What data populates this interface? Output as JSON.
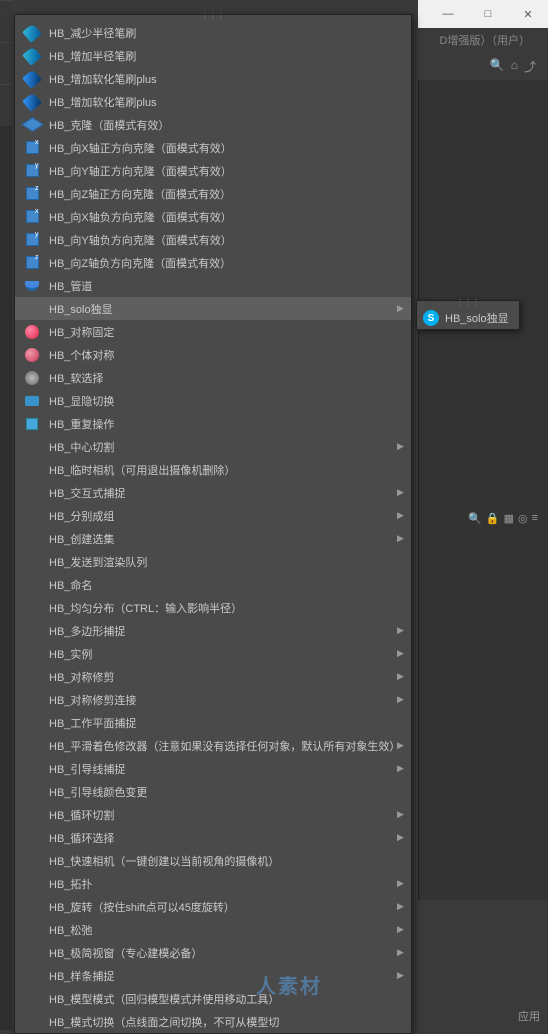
{
  "window": {
    "minimize": "—",
    "maximize": "□",
    "close": "✕",
    "header_suffix": "D增强版）（用户）"
  },
  "toolbar_right": {
    "search": "🔍",
    "home": "⌂",
    "arrow": "⤴"
  },
  "right_tools": {
    "search": "🔍",
    "lock": "🔒",
    "grid": "▦",
    "target": "◎",
    "menu": "≡"
  },
  "menu": {
    "items": [
      {
        "icon": "brush",
        "label": "HB_减少半径笔刷",
        "sub": false
      },
      {
        "icon": "brush",
        "label": "HB_增加半径笔刷",
        "sub": false
      },
      {
        "icon": "brush2",
        "label": "HB_增加软化笔刷plus",
        "sub": false
      },
      {
        "icon": "brush2",
        "label": "HB_增加软化笔刷plus",
        "sub": false
      },
      {
        "icon": "cube",
        "label": "HB_克隆（面模式有效）",
        "sub": false
      },
      {
        "icon": "cubex",
        "label": "HB_向X轴正方向克隆（面模式有效）",
        "sub": false
      },
      {
        "icon": "cubey",
        "label": "HB_向Y轴正方向克隆（面模式有效）",
        "sub": false
      },
      {
        "icon": "cubez",
        "label": "HB_向Z轴正方向克隆（面模式有效）",
        "sub": false
      },
      {
        "icon": "cubex",
        "label": "HB_向X轴负方向克隆（面模式有效）",
        "sub": false
      },
      {
        "icon": "cubey",
        "label": "HB_向Y轴负方向克隆（面模式有效）",
        "sub": false
      },
      {
        "icon": "cubez",
        "label": "HB_向Z轴负方向克隆（面模式有效）",
        "sub": false
      },
      {
        "icon": "pipe",
        "label": "HB_管道",
        "sub": false
      },
      {
        "icon": "none",
        "label": "HB_solo独显",
        "sub": true,
        "hl": true
      },
      {
        "icon": "sphere-r",
        "label": "HB_对称固定",
        "sub": false
      },
      {
        "icon": "sphere-b",
        "label": "HB_个体对称",
        "sub": false
      },
      {
        "icon": "soft",
        "label": "HB_软选择",
        "sub": false
      },
      {
        "icon": "vis",
        "label": "HB_显隐切换",
        "sub": false
      },
      {
        "icon": "cube2",
        "label": "HB_重复操作",
        "sub": false
      },
      {
        "icon": "none",
        "label": "HB_中心切割",
        "sub": true
      },
      {
        "icon": "none",
        "label": "HB_临时相机（可用退出摄像机删除）",
        "sub": false
      },
      {
        "icon": "none",
        "label": "HB_交互式捕捉",
        "sub": true
      },
      {
        "icon": "none",
        "label": "HB_分别成组",
        "sub": true
      },
      {
        "icon": "none",
        "label": "HB_创建选集",
        "sub": true
      },
      {
        "icon": "none",
        "label": "HB_发送到渲染队列",
        "sub": false
      },
      {
        "icon": "none",
        "label": "HB_命名",
        "sub": false
      },
      {
        "icon": "none",
        "label": "HB_均匀分布（CTRL：输入影响半径）",
        "sub": false
      },
      {
        "icon": "none",
        "label": "HB_多边形捕捉",
        "sub": true
      },
      {
        "icon": "none",
        "label": "HB_实例",
        "sub": true
      },
      {
        "icon": "none",
        "label": "HB_对称修剪",
        "sub": true
      },
      {
        "icon": "none",
        "label": "HB_对称修剪连接",
        "sub": true
      },
      {
        "icon": "none",
        "label": "HB_工作平面捕捉",
        "sub": false
      },
      {
        "icon": "none",
        "label": "HB_平滑着色修改器（注意如果没有选择任何对象，默认所有对象生效）",
        "sub": true
      },
      {
        "icon": "none",
        "label": "HB_引导线捕捉",
        "sub": true
      },
      {
        "icon": "none",
        "label": "HB_引导线颜色变更",
        "sub": false
      },
      {
        "icon": "none",
        "label": "HB_循环切割",
        "sub": true
      },
      {
        "icon": "none",
        "label": "HB_循环选择",
        "sub": true
      },
      {
        "icon": "none",
        "label": "HB_快速相机（一键创建以当前视角的摄像机）",
        "sub": false
      },
      {
        "icon": "none",
        "label": "HB_拓扑",
        "sub": true
      },
      {
        "icon": "none",
        "label": "HB_旋转（按住shift点可以45度旋转）",
        "sub": true
      },
      {
        "icon": "none",
        "label": "HB_松弛",
        "sub": true
      },
      {
        "icon": "none",
        "label": "HB_极简视窗（专心建模必备）",
        "sub": true
      },
      {
        "icon": "none",
        "label": "HB_样条捕捉",
        "sub": true
      },
      {
        "icon": "none",
        "label": "HB_模型模式（回归模型模式并使用移动工具）",
        "sub": false
      },
      {
        "icon": "none",
        "label": "HB_模式切换（点线面之间切换，不可从模型切",
        "sub": false
      }
    ]
  },
  "submenu": {
    "label": "HB_solo独显"
  },
  "bottom": {
    "apply": "应用"
  },
  "watermark": "人素材"
}
